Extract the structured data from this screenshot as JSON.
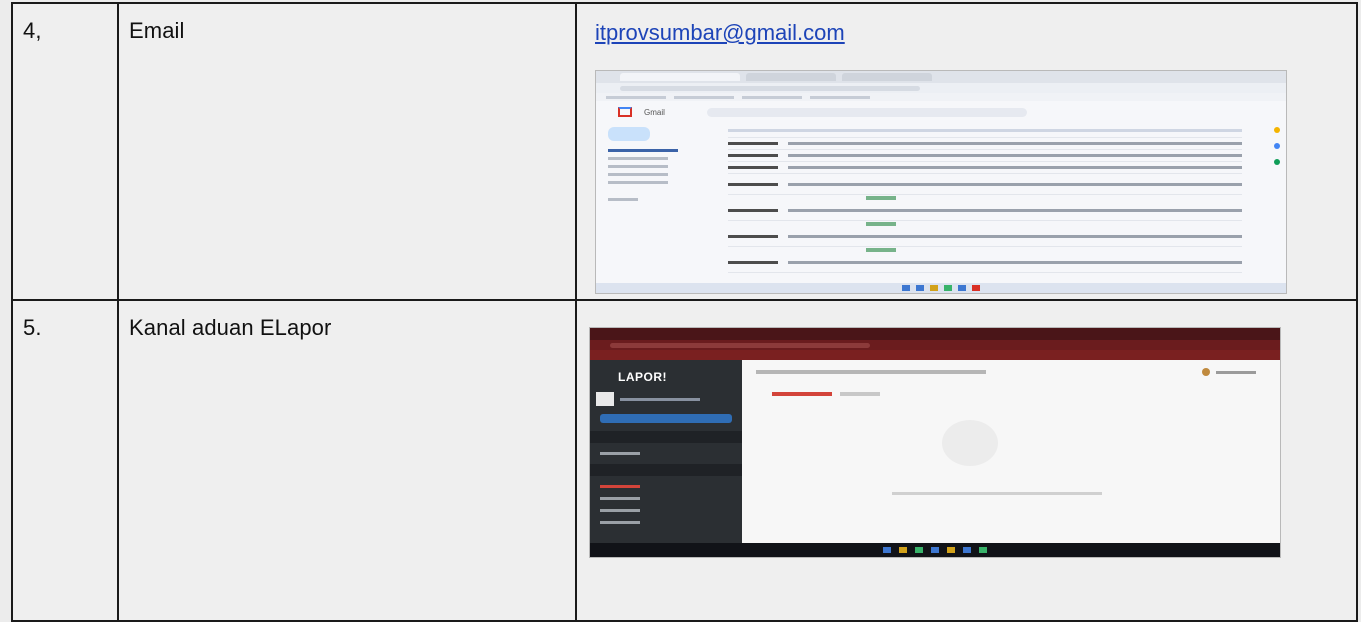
{
  "rows": [
    {
      "number": "4,",
      "label": "Email",
      "value_link": "itprovsumbar@gmail.com",
      "evidence_app": "Gmail"
    },
    {
      "number": "5.",
      "label": "Kanal aduan ELapor",
      "value_link": "",
      "evidence_app": "LAPOR!"
    }
  ],
  "colors": {
    "link": "#1d44b8",
    "border": "#1a1a1a",
    "lapor_header": "#6b1c1e",
    "lapor_sidebar": "#2b2f33"
  }
}
